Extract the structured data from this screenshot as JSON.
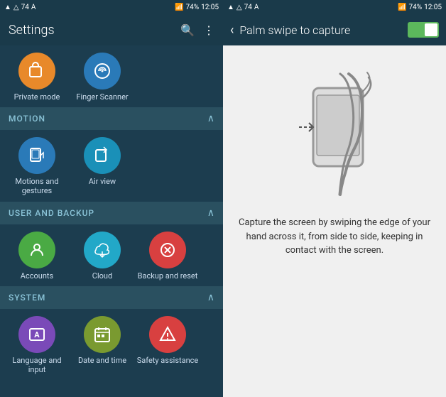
{
  "left": {
    "statusBar": {
      "left": [
        "▲",
        "△",
        "74",
        "A"
      ],
      "time": "12:05",
      "right": [
        "📶",
        "74%",
        "🔋"
      ]
    },
    "header": {
      "title": "Settings",
      "searchLabel": "🔍",
      "moreLabel": "⋮"
    },
    "privateMode": {
      "label": "Private mode",
      "color": "#e8892a"
    },
    "fingerScanner": {
      "label": "Finger Scanner",
      "color": "#2a7ab8"
    },
    "motionSection": "MOTION",
    "motionsGestures": {
      "label": "Motions and gestures",
      "color": "#2a7ab8"
    },
    "airView": {
      "label": "Air view",
      "color": "#2a90b8"
    },
    "userBackupSection": "USER AND BACKUP",
    "accounts": {
      "label": "Accounts",
      "color": "#4aaa44"
    },
    "cloud": {
      "label": "Cloud",
      "color": "#22a8c8"
    },
    "backupReset": {
      "label": "Backup and reset",
      "color": "#d84040"
    },
    "systemSection": "SYSTEM",
    "languageInput": {
      "label": "Language and input",
      "color": "#7a4ab8"
    },
    "dateTime": {
      "label": "Date and time",
      "color": "#7a9a30"
    },
    "safetyAssistance": {
      "label": "Safety assistance",
      "color": "#d84040"
    }
  },
  "right": {
    "statusBar": {
      "left": [
        "▲",
        "△",
        "74",
        "A"
      ],
      "time": "12:05",
      "right": [
        "📶",
        "74%",
        "🔋"
      ]
    },
    "header": {
      "backLabel": "‹",
      "title": "Palm swipe to capture",
      "toggleOn": true
    },
    "description": "Capture the screen by swiping the edge of your hand across it, from side to side, keeping in contact with the screen."
  }
}
